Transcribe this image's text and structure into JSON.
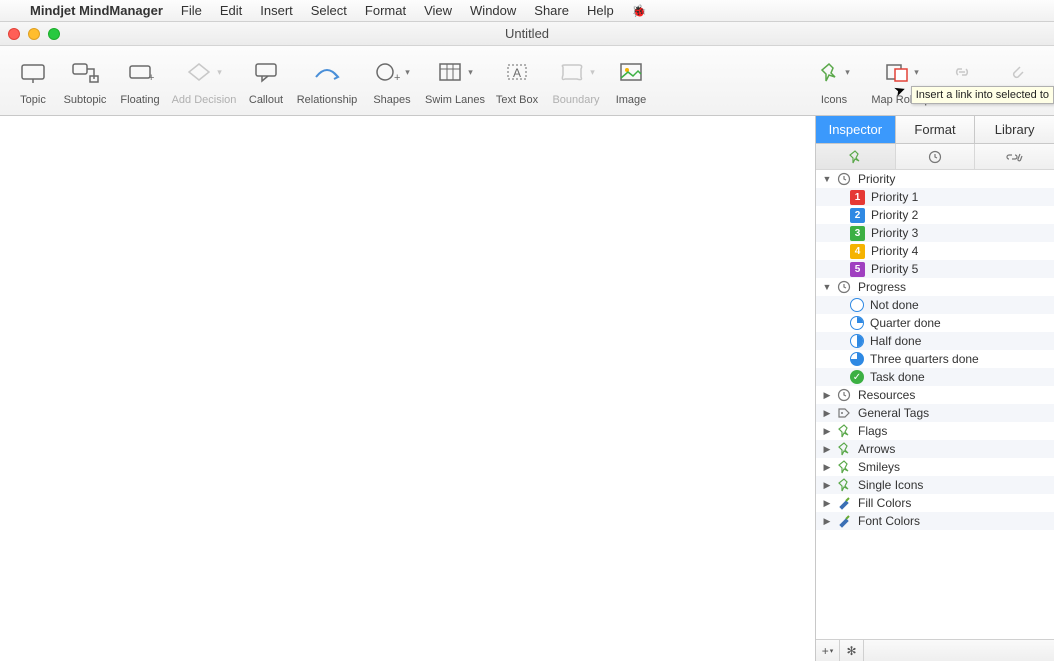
{
  "menubar": {
    "appname": "Mindjet MindManager",
    "items": [
      "File",
      "Edit",
      "Insert",
      "Select",
      "Format",
      "View",
      "Window",
      "Share",
      "Help"
    ]
  },
  "window": {
    "title": "Untitled"
  },
  "toolbar": {
    "items": [
      {
        "label": "Topic",
        "dim": false,
        "dd": false
      },
      {
        "label": "Subtopic",
        "dim": false,
        "dd": false
      },
      {
        "label": "Floating",
        "dim": false,
        "dd": false
      },
      {
        "label": "Add Decision",
        "dim": true,
        "dd": true
      },
      {
        "label": "Callout",
        "dim": false,
        "dd": false
      },
      {
        "label": "Relationship",
        "dim": false,
        "dd": false
      },
      {
        "label": "Shapes",
        "dim": false,
        "dd": true
      },
      {
        "label": "Swim Lanes",
        "dim": false,
        "dd": true
      },
      {
        "label": "Text Box",
        "dim": false,
        "dd": false
      },
      {
        "label": "Boundary",
        "dim": true,
        "dd": true
      },
      {
        "label": "Image",
        "dim": false,
        "dd": false
      }
    ],
    "right": [
      {
        "label": "Icons",
        "dim": false,
        "dd": true
      },
      {
        "label": "Map Roll-up",
        "dim": false,
        "dd": true
      },
      {
        "label": "Link",
        "dim": true,
        "dd": false
      },
      {
        "label": "Attach File",
        "dim": true,
        "dd": false
      }
    ]
  },
  "tooltip": "Insert a link into selected to",
  "inspector": {
    "tabs": [
      "Inspector",
      "Format",
      "Library"
    ],
    "activeTab": "Inspector",
    "groups": [
      {
        "label": "Priority",
        "open": true,
        "icon": "clock",
        "children": [
          {
            "label": "Priority 1",
            "k": "num",
            "c": "bg-red",
            "n": "1"
          },
          {
            "label": "Priority 2",
            "k": "num",
            "c": "bg-blue",
            "n": "2"
          },
          {
            "label": "Priority 3",
            "k": "num",
            "c": "bg-green",
            "n": "3"
          },
          {
            "label": "Priority 4",
            "k": "num",
            "c": "bg-gold",
            "n": "4"
          },
          {
            "label": "Priority 5",
            "k": "num",
            "c": "bg-purple",
            "n": "5"
          }
        ]
      },
      {
        "label": "Progress",
        "open": true,
        "icon": "clock",
        "children": [
          {
            "label": "Not done",
            "k": "circ",
            "c": ""
          },
          {
            "label": "Quarter done",
            "k": "circ",
            "c": "q25"
          },
          {
            "label": "Half done",
            "k": "circ",
            "c": "q50"
          },
          {
            "label": "Three quarters done",
            "k": "circ",
            "c": "q75"
          },
          {
            "label": "Task done",
            "k": "check",
            "c": ""
          }
        ]
      },
      {
        "label": "Resources",
        "open": false,
        "icon": "clock"
      },
      {
        "label": "General Tags",
        "open": false,
        "icon": "tag"
      },
      {
        "label": "Flags",
        "open": false,
        "icon": "pin"
      },
      {
        "label": "Arrows",
        "open": false,
        "icon": "pin"
      },
      {
        "label": "Smileys",
        "open": false,
        "icon": "pin"
      },
      {
        "label": "Single Icons",
        "open": false,
        "icon": "pin"
      },
      {
        "label": "Fill Colors",
        "open": false,
        "icon": "brush"
      },
      {
        "label": "Font Colors",
        "open": false,
        "icon": "brush"
      }
    ]
  }
}
